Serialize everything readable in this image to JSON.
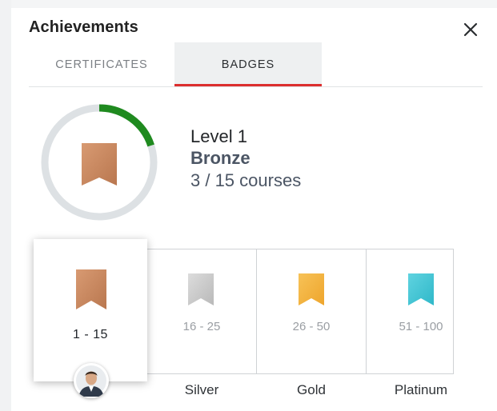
{
  "header": {
    "title": "Achievements"
  },
  "tabs": [
    {
      "label": "CERTIFICATES",
      "active": false
    },
    {
      "label": "BADGES",
      "active": true
    }
  ],
  "progress": {
    "level": "Level 1",
    "tier": "Bronze",
    "courses": "3 / 15 courses",
    "fraction": 0.2,
    "ring_color": "#1f8a1f"
  },
  "badges": [
    {
      "name": "",
      "range": "1 - 15",
      "color": "#c8895f",
      "selected": true
    },
    {
      "name": "Silver",
      "range": "16 - 25",
      "color": "#c7c7c7",
      "selected": false
    },
    {
      "name": "Gold",
      "range": "26 - 50",
      "color": "#f3b23c",
      "selected": false
    },
    {
      "name": "Platinum",
      "range": "51 - 100",
      "color": "#3fc6d6",
      "selected": false
    }
  ],
  "icons": {
    "close": "close-icon",
    "badge": "ribbon-badge-icon",
    "avatar": "user-avatar"
  },
  "colors": {
    "accent_underline": "#dc2e2e",
    "tier_text": "#4b5564"
  }
}
